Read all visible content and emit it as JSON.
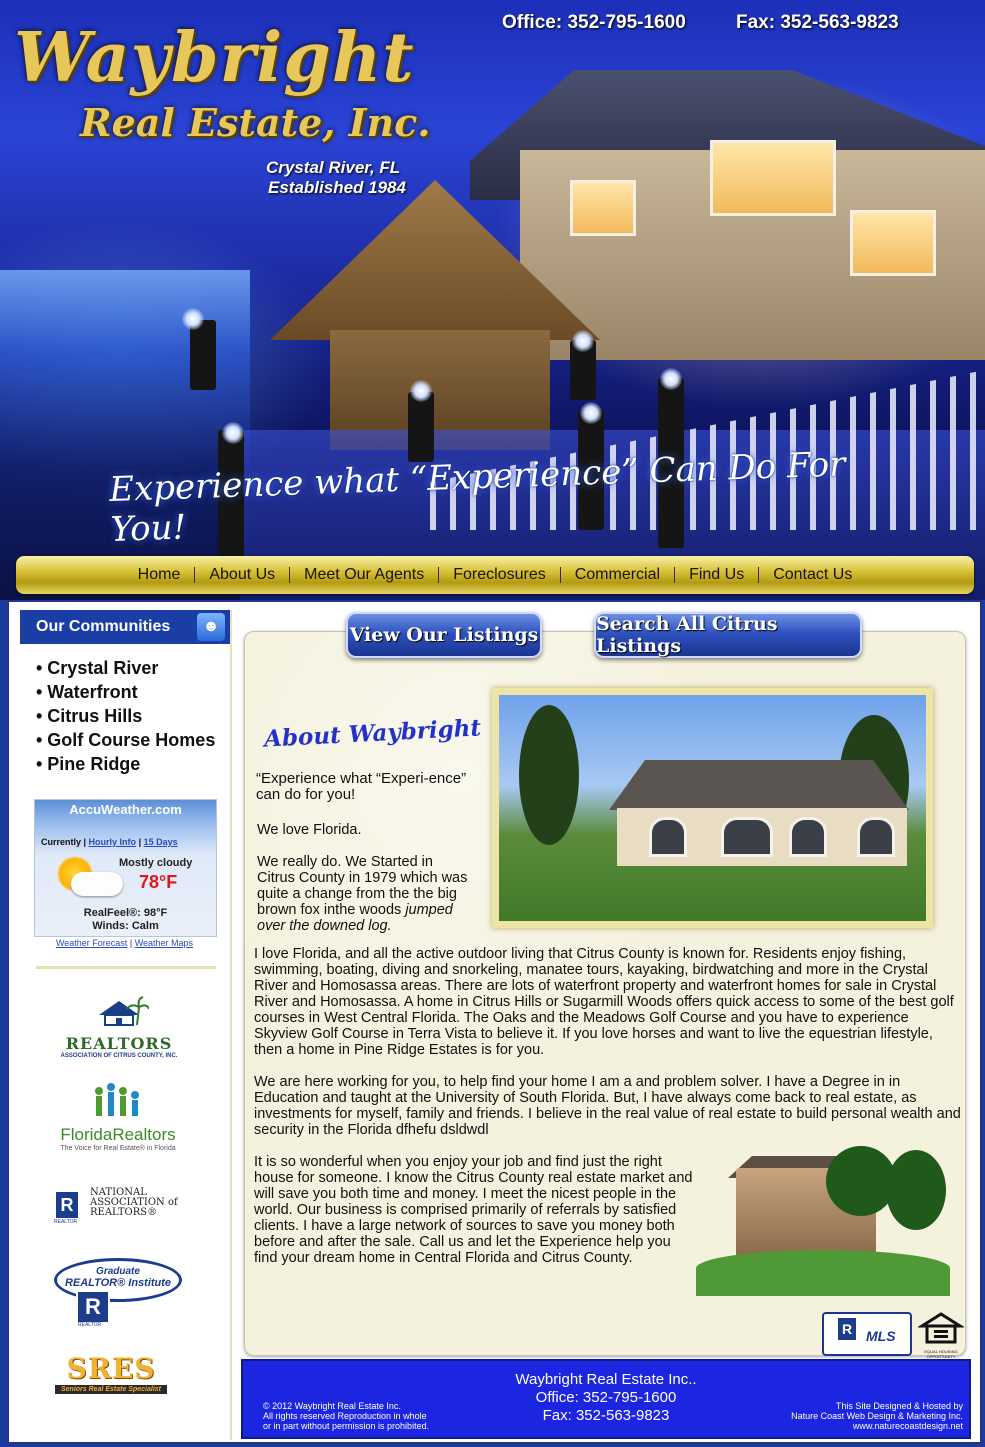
{
  "header": {
    "brand": "Waybright",
    "brand_sub": "Real Estate, Inc.",
    "location": "Crystal River, FL",
    "established": "Established 1984",
    "office": "Office: 352-795-1600",
    "fax": "Fax: 352-563-9823",
    "tagline": "Experience what “Experience” Can Do For You!"
  },
  "nav": {
    "items": [
      {
        "label": "Home"
      },
      {
        "label": "About Us"
      },
      {
        "label": "Meet Our Agents"
      },
      {
        "label": "Foreclosures"
      },
      {
        "label": "Commercial"
      },
      {
        "label": "Find Us"
      },
      {
        "label": "Contact Us"
      }
    ]
  },
  "sidebar": {
    "communities_title": "Our Communities",
    "communities_icon": "people-icon",
    "communities": [
      {
        "label": "• Crystal River"
      },
      {
        "label": "• Waterfront"
      },
      {
        "label": "• Citrus Hills"
      },
      {
        "label": "• Golf Course Homes"
      },
      {
        "label": "• Pine Ridge"
      }
    ],
    "weather": {
      "brand": "AccuWeather.com",
      "currently": "Currently |",
      "hourly": "Hourly Info",
      "sep": "|",
      "days": "15 Days",
      "condition": "Mostly cloudy",
      "temp": "78°F",
      "realfeel": "RealFeel®: 98°F",
      "winds": "Winds: Calm",
      "forecast_link": "Weather Forecast",
      "bar": "|",
      "maps_link": "Weather Maps"
    },
    "logos": {
      "realtors_main": "REALTORS",
      "realtors_sub": "ASSOCIATION OF CITRUS COUNTY, INC.",
      "fr_main": "FloridaRealtors",
      "fr_sub": "The Voice for Real Estate® in Florida",
      "nar_line1": "NATIONAL",
      "nar_line2": "ASSOCIATION of",
      "nar_line3": "REALTORS®",
      "nar_r": "R",
      "nar_realtor": "REALTOR",
      "gri_line1": "Graduate",
      "gri_line2": "REALTOR® Institute",
      "gri_realtor": "REALTOR",
      "sres_main": "SRES",
      "sres_sub": "Seniors Real Estate Specialist"
    }
  },
  "main": {
    "btn_listings": "View Our Listings",
    "btn_search": "Search All Citrus Listings",
    "about_title": "About Waybright",
    "p_quote": "“Experience what “Experi-ence” can do for you!",
    "p_love": "We love Florida.",
    "p_started": "We really do. We Started in Citrus County in 1979 which was quite a change from the the big brown fox inthe woods",
    "p_started_italic": "jumped over the downed log.",
    "p1": "I love Florida, and all the active outdoor living that Citrus County is known for. Residents enjoy fishing, swimming, boating, diving and snorkeling, manatee tours, kayaking, birdwatching and more in the Crystal River and Homosassa areas. There are lots of waterfront property and waterfront homes for sale in Crystal River and Homosassa. A home in Citrus Hills or Sugarmill Woods offers quick access to some of the best golf courses in West Central Florida. The Oaks and the Meadows Golf Course and you have to experience Skyview Golf Course in Terra Vista to believe it. If you love horses and want to live the equestrian lifestyle, then a home in Pine Ridge Estates is for you.",
    "p2": "We are here working for you, to help find your home I am a and problem solver. I have a  Degree in  in Education and taught at the University of South Florida. But, I have always come back to real estate, as investments for myself, family and friends. I believe in the real value of real estate to build personal wealth and security in the Florida dfhefu dsldwdl",
    "p3": "It is so wonderful when you enjoy your job and find just the right house for someone. I know the Citrus County real estate market and will save you both time and money. I meet the nicest people in the world.  Our business is comprised primarily of referrals by satisfied clients. I have a large network of sources to save you money both before and after the sale. Call us and let the Experience help you find your dream home in Central Florida and Citrus County.",
    "mls_label": "MLS",
    "mls_r": "R",
    "eh_label": "EQUAL HOUSING OPPORTUNITY"
  },
  "footer": {
    "company": "Waybright Real Estate Inc..",
    "office": "Office: 352-795-1600",
    "fax": "Fax: 352-563-9823",
    "copy1": "© 2012 Waybright Real Estate Inc.",
    "copy2": "All rights reserved Reproduction in whole",
    "copy3": "or in part without permission is prohibited.",
    "design1": "This Site Designed & Hosted by",
    "design2": "Nature Coast Web Design & Marketing Inc.",
    "design3": "www.naturecoastdesign.net"
  }
}
